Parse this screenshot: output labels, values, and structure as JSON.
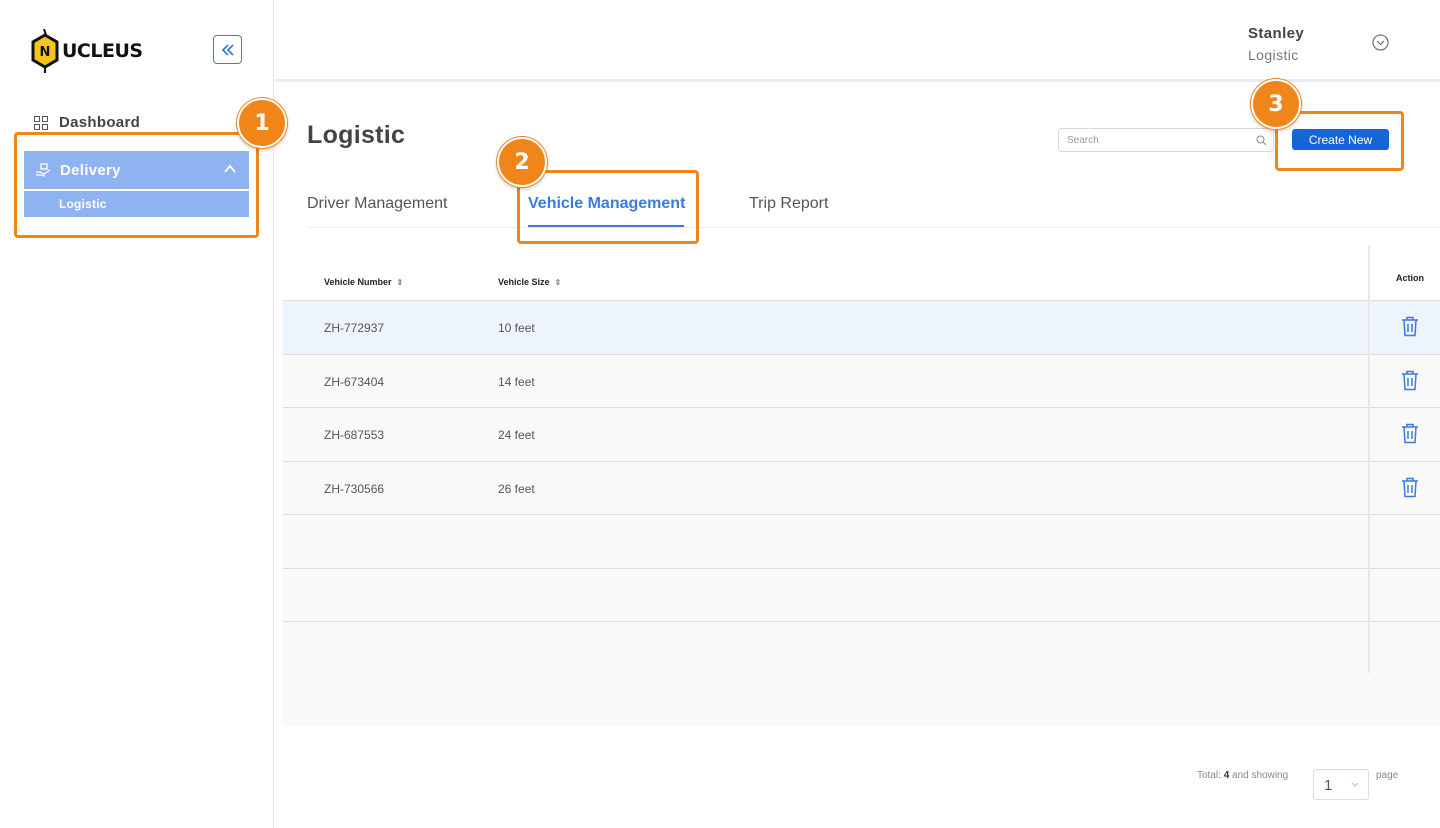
{
  "brand": {
    "logo_letter": "N",
    "logo_text": "UCLEUS"
  },
  "sidebar": {
    "collapse_icon": "double-chevron-left-icon",
    "items": [
      {
        "label": "Dashboard",
        "icon": "dashboard-grid-icon"
      },
      {
        "label": "Delivery",
        "icon": "delivery-hand-icon",
        "expanded": true,
        "children": [
          {
            "label": "Logistic"
          }
        ]
      }
    ]
  },
  "header": {
    "user_name": "Stanley",
    "user_role": "Logistic",
    "menu_icon": "chevron-down-circle-icon"
  },
  "main": {
    "title": "Logistic",
    "search": {
      "placeholder": "Search",
      "value": ""
    },
    "create_button": "Create New",
    "tabs": [
      {
        "label": "Driver Management",
        "active": false
      },
      {
        "label": "Vehicle Management",
        "active": true
      },
      {
        "label": "Trip Report",
        "active": false
      }
    ]
  },
  "table": {
    "columns": [
      "Vehicle Number",
      "Vehicle Size",
      "Action"
    ],
    "rows": [
      {
        "vehicle_number": "ZH-772937",
        "vehicle_size": "10 feet"
      },
      {
        "vehicle_number": "ZH-673404",
        "vehicle_size": "14 feet"
      },
      {
        "vehicle_number": "ZH-687553",
        "vehicle_size": "24 feet"
      },
      {
        "vehicle_number": "ZH-730566",
        "vehicle_size": "26 feet"
      }
    ]
  },
  "pagination": {
    "total_prefix": "Total:",
    "total": "4",
    "showing_text": "and showing",
    "page_value": "1",
    "page_suffix": "page"
  },
  "annotations": [
    "1",
    "2",
    "3"
  ],
  "colors": {
    "accent": "#3a7be0",
    "button": "#1565d8",
    "sidebar_active": "#8fb3f0",
    "annotation": "#f0861a"
  }
}
